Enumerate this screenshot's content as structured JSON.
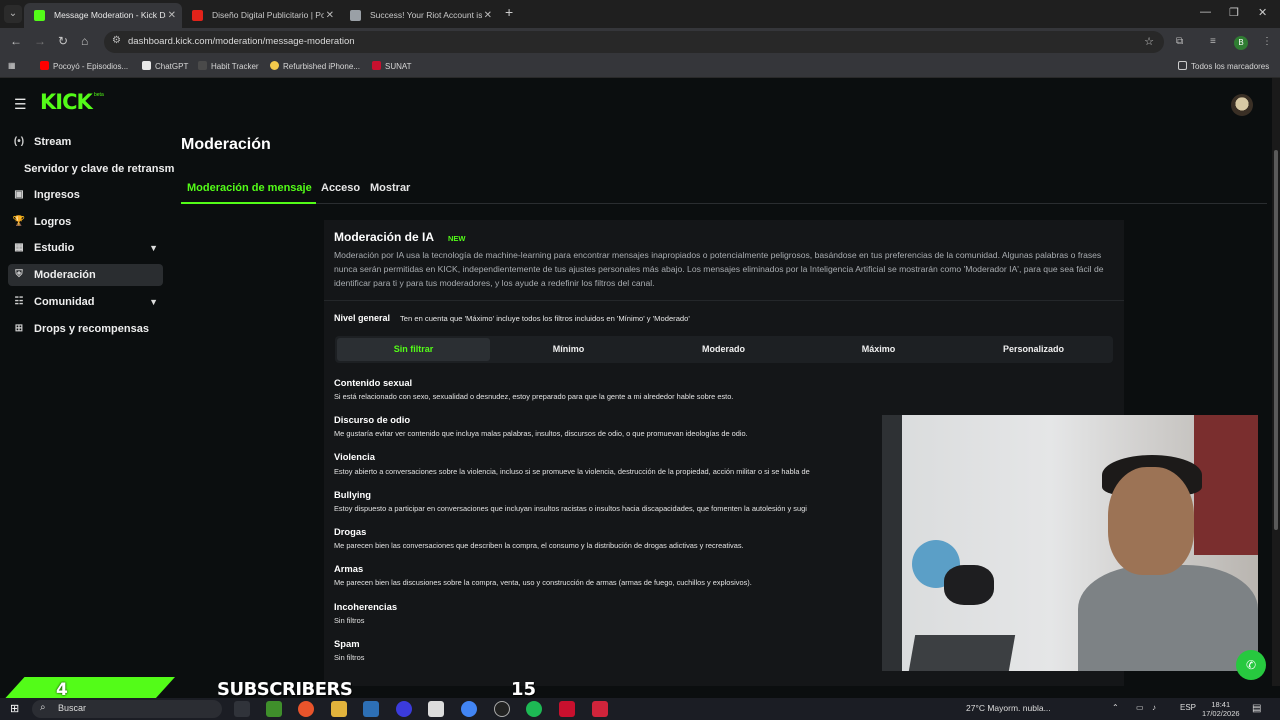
{
  "browser": {
    "tabs": [
      {
        "title": "Message Moderation - Kick Da",
        "active": true,
        "favicon_color": "#53fc18"
      },
      {
        "title": "Diseño Digital Publicitario | Por",
        "active": false,
        "favicon_color": "#e2231a"
      },
      {
        "title": "Success! Your Riot Account is n",
        "active": false,
        "favicon_color": "#9aa0a6"
      }
    ],
    "url": "dashboard.kick.com/moderation/message-moderation",
    "bookmarks": [
      {
        "label": "Pocoyó - Episodios...",
        "color": "#ff0000"
      },
      {
        "label": "ChatGPT",
        "color": "#e8e8e8"
      },
      {
        "label": "Habit Tracker",
        "color": "#4a4a4a"
      },
      {
        "label": "Refurbished iPhone...",
        "color": "#f2c94c"
      },
      {
        "label": "SUNAT",
        "color": "#c8102e"
      }
    ],
    "bookmarks_all": "Todos los marcadores",
    "profile_initial": "B"
  },
  "app": {
    "logo": "KICK",
    "logo_badge": "beta"
  },
  "sidebar": {
    "items": [
      {
        "label": "Stream",
        "icon": "broadcast-icon",
        "glyph": "(•)",
        "expandable": false,
        "active": false
      },
      {
        "label": "Ingresos",
        "icon": "wallet-icon",
        "glyph": "▣",
        "expandable": false,
        "active": false
      },
      {
        "label": "Logros",
        "icon": "trophy-icon",
        "glyph": "🏆",
        "expandable": false,
        "active": false
      },
      {
        "label": "Estudio",
        "icon": "studio-icon",
        "glyph": "▦",
        "expandable": true,
        "active": false
      },
      {
        "label": "Moderación",
        "icon": "shield-icon",
        "glyph": "⛨",
        "expandable": false,
        "active": true
      },
      {
        "label": "Comunidad",
        "icon": "community-icon",
        "glyph": "☷",
        "expandable": true,
        "active": false
      },
      {
        "label": "Drops y recompensas",
        "icon": "gift-icon",
        "glyph": "⊞",
        "expandable": false,
        "active": false
      }
    ],
    "sub_item": "Servidor y clave de retransm"
  },
  "main": {
    "title": "Moderación",
    "tabs": [
      {
        "label": "Moderación de mensaje",
        "active": true
      },
      {
        "label": "Acceso",
        "active": false
      },
      {
        "label": "Mostrar",
        "active": false
      }
    ],
    "ai": {
      "title": "Moderación de IA",
      "badge": "NEW",
      "description": "Moderación por IA usa la tecnología de machine-learning para encontrar mensajes inapropiados o potencialmente peligrosos, basándose en tus preferencias de la comunidad. Algunas palabras o frases nunca serán permitidas en KICK, independientemente de tus ajustes personales más abajo. Los mensajes eliminados por la Inteligencia Artificial se mostrarán como 'Moderador IA', para que sea fácil de identificar para ti y para tus moderadores, y los ayude a redefinir los filtros del canal."
    },
    "level": {
      "label": "Nivel general",
      "note": "Ten en cuenta que 'Máximo' incluye todos los filtros incluidos en 'Mínimo' y 'Moderado'",
      "options": [
        "Sin filtrar",
        "Mínimo",
        "Moderado",
        "Máximo",
        "Personalizado"
      ],
      "selected": "Sin filtrar"
    },
    "categories": [
      {
        "title": "Contenido sexual",
        "desc": "Si está relacionado con sexo, sexualidad o desnudez, estoy preparado para que la gente a mi alrededor hable sobre esto."
      },
      {
        "title": "Discurso de odio",
        "desc": "Me gustaría evitar ver contenido que incluya malas palabras, insultos, discursos de odio, o que promuevan ideologías de odio."
      },
      {
        "title": "Violencia",
        "desc": "Estoy abierto a conversaciones sobre la violencia, incluso si se promueve la violencia, destrucción de la propiedad, acción militar o si se habla de"
      },
      {
        "title": "Bullying",
        "desc": "Estoy dispuesto a participar en conversaciones que incluyan insultos racistas o insultos hacia discapacidades, que fomenten la autolesión y sugi"
      },
      {
        "title": "Drogas",
        "desc": "Me parecen bien las conversaciones que describen la compra, el consumo y la distribución de drogas adictivas y recreativas."
      },
      {
        "title": "Armas",
        "desc": "Me parecen bien las discusiones sobre la compra, venta, uso y construcción de armas (armas de fuego, cuchillos y explosivos)."
      },
      {
        "title": "Incoherencias",
        "desc": "Sin filtros"
      },
      {
        "title": "Spam",
        "desc": "Sin filtros"
      }
    ]
  },
  "overlay": {
    "subscriber_count": "4",
    "subscriber_label": "SUBSCRIBERS",
    "subscriber_goal": "15"
  },
  "taskbar": {
    "search_placeholder": "Buscar",
    "weather": "27°C  Mayorm. nubla...",
    "language": "ESP",
    "time": "18:41",
    "date": "17/02/2026"
  }
}
